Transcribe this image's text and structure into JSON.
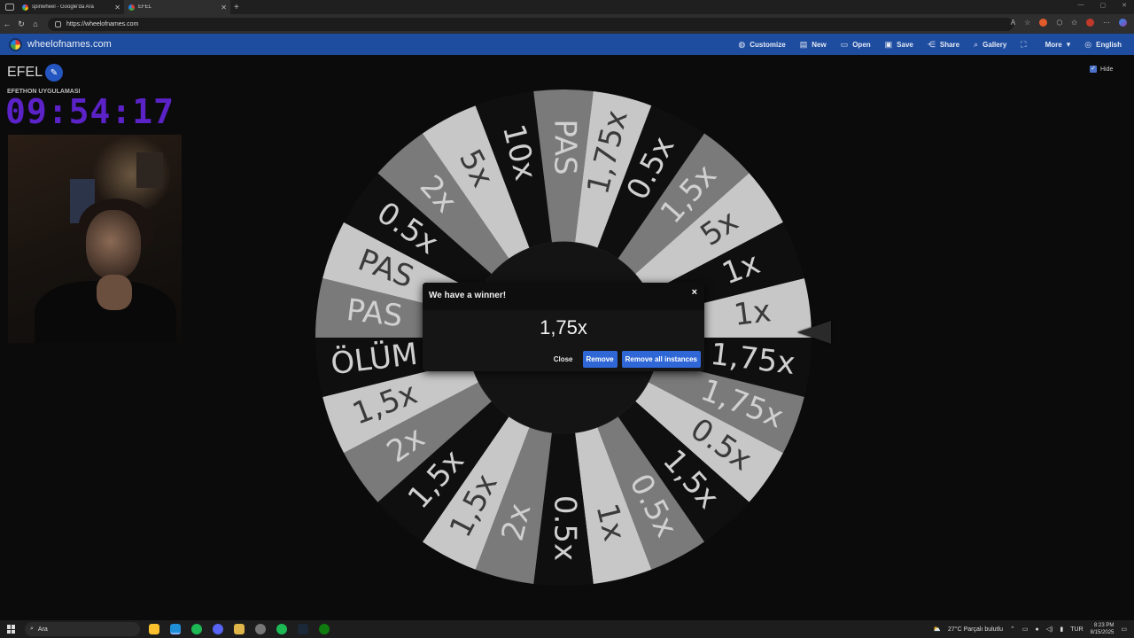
{
  "browser": {
    "tabs": [
      {
        "title": "spinwheel - Google'da Ara"
      },
      {
        "title": "EFEL"
      }
    ],
    "url": "https://wheelofnames.com"
  },
  "app": {
    "site_name": "wheelofnames.com",
    "menu": [
      {
        "label": "Customize",
        "icon": "palette-icon",
        "glyph": "◍"
      },
      {
        "label": "New",
        "icon": "file-icon",
        "glyph": "▤"
      },
      {
        "label": "Open",
        "icon": "folder-icon",
        "glyph": "▭"
      },
      {
        "label": "Save",
        "icon": "save-icon",
        "glyph": "▣"
      },
      {
        "label": "Share",
        "icon": "share-icon",
        "glyph": "⋲"
      },
      {
        "label": "Gallery",
        "icon": "search-icon",
        "glyph": "⌕"
      },
      {
        "label": "",
        "icon": "fullscreen-icon",
        "glyph": "⛶"
      },
      {
        "label": "More",
        "icon": "chevron-down-icon",
        "glyph": "▾"
      },
      {
        "label": "English",
        "icon": "globe-icon",
        "glyph": "◎"
      }
    ]
  },
  "wheel": {
    "title": "EFEL",
    "overlay_label": "EFETHON UYGULAMASI",
    "timer": "09:54:17",
    "hide_label": "Hide",
    "segments": [
      "1x",
      "1,75x",
      "1,75x",
      "0.5x",
      "1,5x",
      "0.5x",
      "1x",
      "0.5x",
      "2x",
      "1,5x",
      "1,5x",
      "2x",
      "1,5x",
      "ÖLÜM",
      "PAS",
      "PAS",
      "0.5x",
      "2x",
      "5x",
      "10x",
      "PAS",
      "1,75x",
      "0.5x",
      "1,5x",
      "5x",
      "1x"
    ],
    "colors": {
      "dark": "#0f0f0f",
      "mid": "#7a7a7a",
      "light": "#c7c7c7",
      "hub": "#141414"
    }
  },
  "dialog": {
    "title": "We have a winner!",
    "close_glyph": "×",
    "winner": "1,75x",
    "close_label": "Close",
    "remove_label": "Remove",
    "remove_all_label": "Remove all instances"
  },
  "taskbar": {
    "search_label": "Ara",
    "weather": "27°C  Parçalı bulutlu",
    "lang": "TUR",
    "time": "8:23 PM",
    "date": "8/15/2025"
  }
}
